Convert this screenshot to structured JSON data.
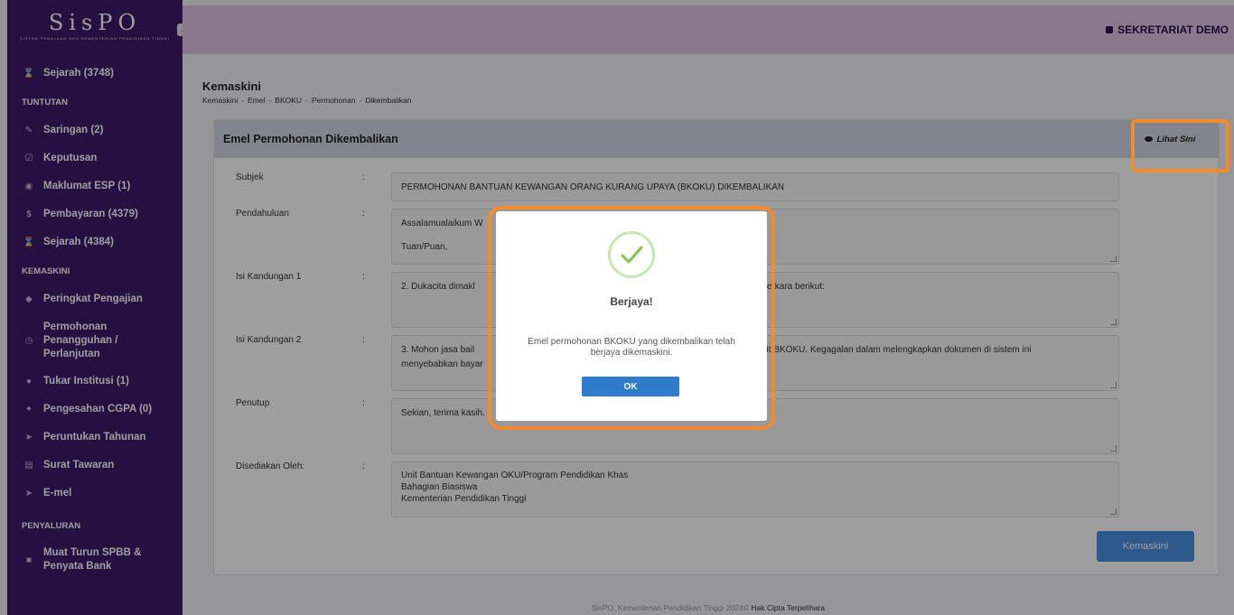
{
  "sidebar": {
    "logo": "SisPO",
    "logo_sub": "SISTEM PENAJAAN OKU KEMENTERIAN PENDIDIKAN TINGGI",
    "history_top": "Sejarah (3748)",
    "section_tuntutan": "TUNTUTAN",
    "tuntutan": [
      "Saringan (2)",
      "Keputusan",
      "Maklumat ESP (1)",
      "Pembayaran (4379)",
      "Sejarah (4384)"
    ],
    "section_kemaskini": "KEMASKINI",
    "kemaskini": [
      "Peringkat Pengajian",
      "Permohonan Penangguhan / Perlanjutan",
      "Tukar Institusi (1)",
      "Pengesahan CGPA (0)",
      "Peruntukan Tahunan",
      "Surat Tawaran",
      "E-mel"
    ],
    "section_penyaluran": "PENYALURAN",
    "penyaluran": [
      "Muat Turun SPBB & Penyata Bank"
    ]
  },
  "topbar": {
    "user": "SEKRETARIAT DEMO"
  },
  "page": {
    "title": "Kemaskini",
    "breadcrumb": [
      "Kemaskini",
      "Emel",
      "BKOKU",
      "Permohonan",
      "Dikembalikan"
    ]
  },
  "card": {
    "title": "Emel Permohonan Dikembalikan",
    "view_label": "Lihat Sini",
    "fields": {
      "subjek": {
        "label": "Subjek",
        "value": "PERMOHONAN BANTUAN KEWANGAN ORANG KURANG UPAYA (BKOKU) DIKEMBALIKAN"
      },
      "pendahuluan": {
        "label": "Pendahuluan",
        "line1": "Assalamualaikum W",
        "line2": "Tuan/Puan,"
      },
      "isi1": {
        "label": "Isi Kandungan 1",
        "left": "2.    Dukacita dimakl",
        "right": "h perkara berikut:"
      },
      "isi2": {
        "label": "Isi Kandungan 2",
        "left1": "3.    Mohon jasa bail",
        "right1": "nit BKOKU. Kegagalan dalam melengkapkan dokumen di sistem ini",
        "left2": "menyebabkan bayar"
      },
      "penutup": {
        "label": "Penutup",
        "value": "Sekian, terima kasih."
      },
      "disediakan": {
        "label": "Disediakan Oleh:",
        "line1": "Unit Bantuan Kewangan OKU/Program Pendidikan Khas",
        "line2": "Bahagian Biasiswa",
        "line3": "Kementerian Pendidikan Tinggi"
      }
    },
    "colon": ":",
    "save_label": "Kemaskini"
  },
  "footer": {
    "text": "SisPO, Kementerian Pendidikan Tinggi 2024©",
    "link": "Hak Cipta Terpelihara"
  },
  "modal": {
    "title": "Berjaya!",
    "message": "Emel permohonan BKOKU yang dikembalikan telah berjaya dikemaskini.",
    "ok_label": "OK"
  },
  "colors": {
    "sidebar": "#3e1a6b",
    "topbar": "#dfc4e2",
    "primary": "#4a90e2",
    "highlight": "#f28a2e",
    "success": "#8bc34a"
  }
}
